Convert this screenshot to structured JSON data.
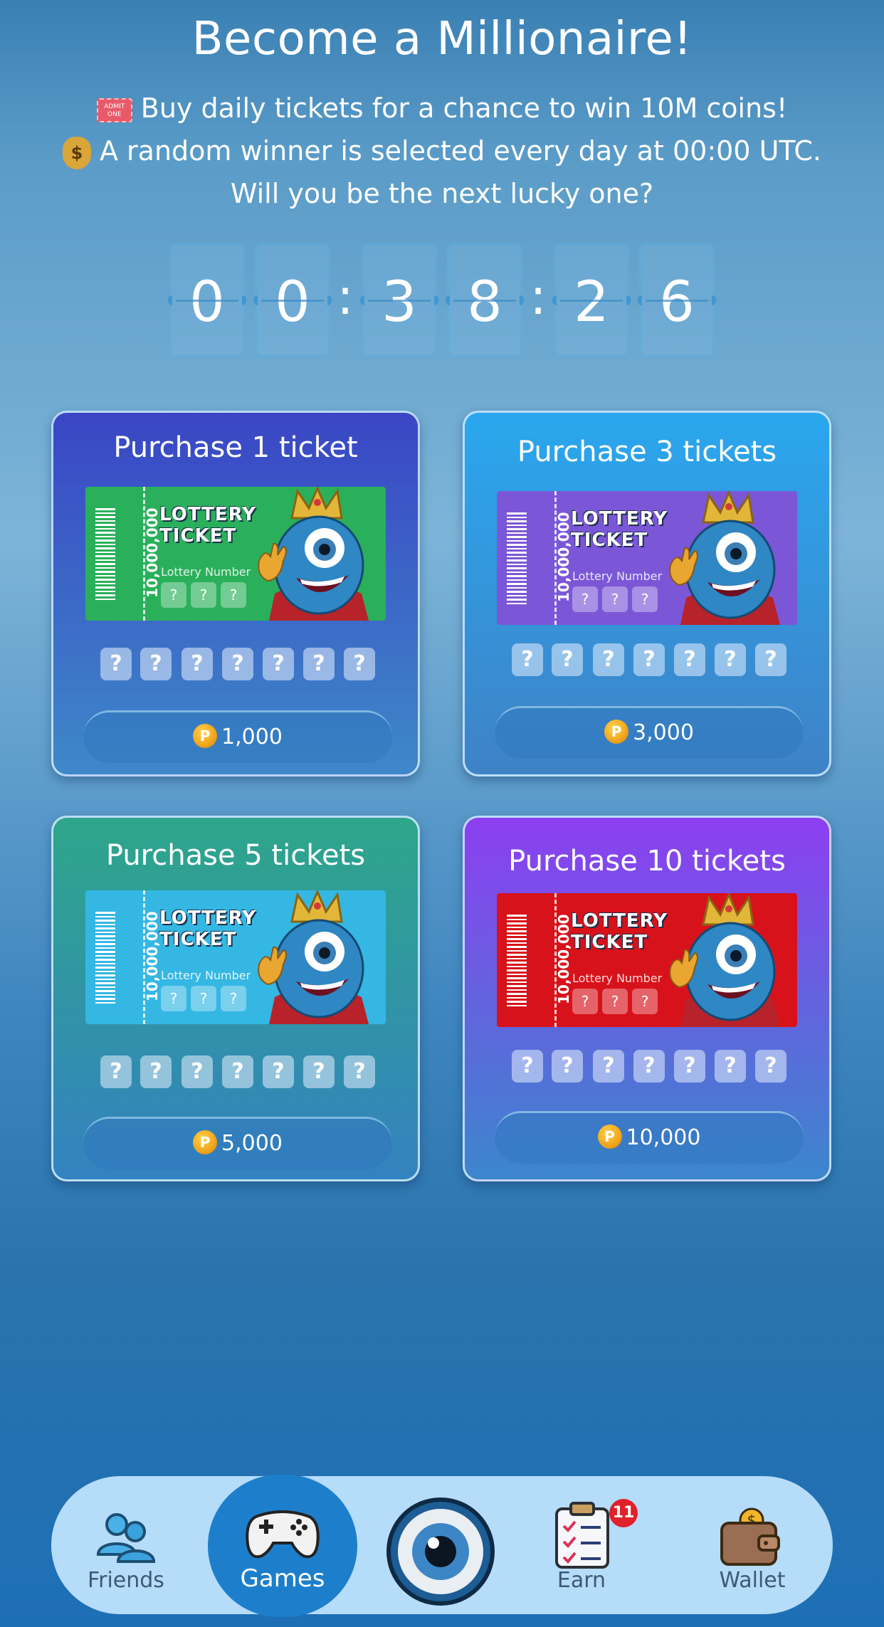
{
  "header": {
    "title": "Become a Millionaire!",
    "line1": "Buy daily tickets for a chance to win 10M coins!",
    "line2": "A random winner is selected every day at 00:00 UTC.",
    "line3": "Will you be the next lucky one?",
    "ticket_emoji_text": "ADMIT ONE",
    "bag_emoji_text": "$"
  },
  "timer": {
    "digits": [
      "0",
      "0",
      "3",
      "8",
      "2",
      "6"
    ],
    "separator": ":"
  },
  "ticket_art": {
    "title_line1": "LOTTERY",
    "title_line2": "TICKET",
    "amount": "10,000,000",
    "number_label": "Lottery Number",
    "unknown": "?"
  },
  "cards": [
    {
      "title": "Purchase 1 ticket",
      "price": "1,000",
      "bg_top": "#3a46c5",
      "bg_bottom": "#3e88c8",
      "ticket_color": "#2ab05a"
    },
    {
      "title": "Purchase 3 tickets",
      "price": "3,000",
      "bg_top": "#2aa7ee",
      "bg_bottom": "#3f82c6",
      "ticket_color": "#7b57d8"
    },
    {
      "title": "Purchase 5 tickets",
      "price": "5,000",
      "bg_top": "#2ea68a",
      "bg_bottom": "#3482c0",
      "ticket_color": "#34b7e3"
    },
    {
      "title": "Purchase 10 tickets",
      "price": "10,000",
      "bg_top": "#8c3ff0",
      "bg_bottom": "#3c86cd",
      "ticket_color": "#d8121a"
    }
  ],
  "coin_symbol": "P",
  "nav": {
    "items": [
      {
        "label": "Friends",
        "icon": "friends-icon"
      },
      {
        "label": "Games",
        "icon": "gamepad-icon",
        "active": true
      },
      {
        "label": "",
        "icon": "eye-icon"
      },
      {
        "label": "Earn",
        "icon": "checklist-icon",
        "badge": "11"
      },
      {
        "label": "Wallet",
        "icon": "wallet-icon"
      }
    ]
  }
}
